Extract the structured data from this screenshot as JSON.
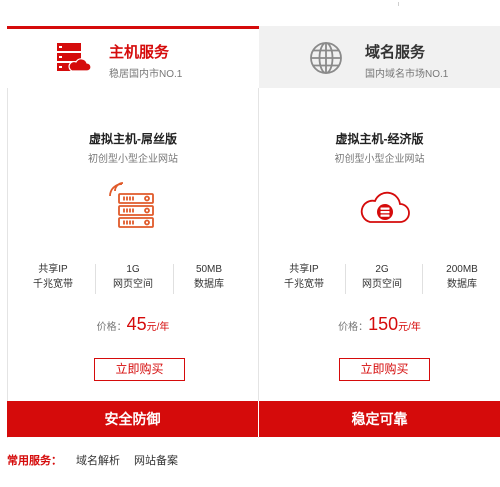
{
  "tabs": [
    {
      "title": "主机服务",
      "subtitle": "稳居国内市NO.1",
      "icon": "server-cloud-icon",
      "active": true
    },
    {
      "title": "域名服务",
      "subtitle": "国内域名市场NO.1",
      "icon": "globe-icon",
      "active": false
    }
  ],
  "products": [
    {
      "name": "虚拟主机-屌丝版",
      "desc": "初创型小型企业网站",
      "icon": "server-rack-icon",
      "specs": [
        {
          "value": "共享IP",
          "label": "千兆宽带"
        },
        {
          "value": "1G",
          "label": "网页空间"
        },
        {
          "value": "50MB",
          "label": "数据库"
        }
      ],
      "price_label": "价格：",
      "price": "45",
      "price_unit": "元/年",
      "buy_label": "立即购买",
      "bar_label": "安全防御"
    },
    {
      "name": "虚拟主机-经济版",
      "desc": "初创型小型企业网站",
      "icon": "cloud-database-icon",
      "specs": [
        {
          "value": "共享IP",
          "label": "千兆宽带"
        },
        {
          "value": "2G",
          "label": "网页空间"
        },
        {
          "value": "200MB",
          "label": "数据库"
        }
      ],
      "price_label": "价格：",
      "price": "150",
      "price_unit": "元/年",
      "buy_label": "立即购买",
      "bar_label": "稳定可靠"
    }
  ],
  "common_services": {
    "label": "常用服务：",
    "links": [
      "域名解析",
      "网站备案"
    ]
  },
  "colors": {
    "accent": "#d50b0b",
    "tab_inactive_bg": "#f1f1f1"
  }
}
